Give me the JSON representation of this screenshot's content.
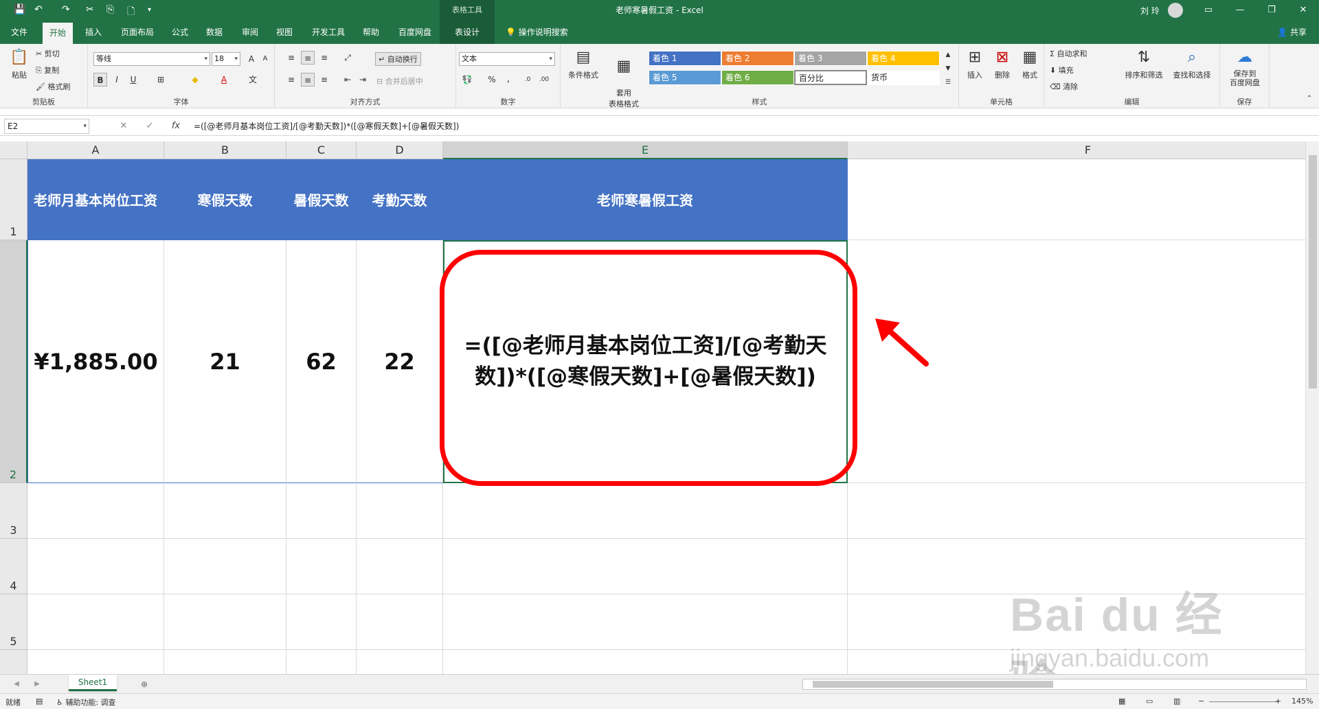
{
  "window": {
    "doc_title": "老师寒暑假工资 - Excel",
    "context_tools": "表格工具",
    "user_name": "刘 玲"
  },
  "tabs": [
    {
      "label": "文件"
    },
    {
      "label": "开始"
    },
    {
      "label": "插入"
    },
    {
      "label": "页面布局"
    },
    {
      "label": "公式"
    },
    {
      "label": "数据"
    },
    {
      "label": "审阅"
    },
    {
      "label": "视图"
    },
    {
      "label": "开发工具"
    },
    {
      "label": "帮助"
    },
    {
      "label": "百度网盘"
    },
    {
      "label": "表设计"
    }
  ],
  "tell_me": "操作说明搜索",
  "share": "共享",
  "ribbon": {
    "clipboard": {
      "label": "剪贴板",
      "paste": "粘贴",
      "cut": "剪切",
      "copy": "复制",
      "format_painter": "格式刷"
    },
    "font": {
      "label": "字体",
      "font_name": "等线",
      "font_size": "18",
      "bold": "B",
      "italic": "I",
      "underline": "U"
    },
    "alignment": {
      "label": "对齐方式",
      "wrap_text": "自动换行",
      "merge_center": "合并后居中"
    },
    "number": {
      "label": "数字",
      "format": "文本"
    },
    "styles": {
      "label": "样式",
      "conditional": "条件格式",
      "table_format": "套用\n表格格式",
      "cells": [
        {
          "label": "着色 1",
          "color": "#4472c4"
        },
        {
          "label": "着色 2",
          "color": "#ed7d31"
        },
        {
          "label": "着色 3",
          "color": "#a5a5a5"
        },
        {
          "label": "着色 4",
          "color": "#ffc000"
        },
        {
          "label": "着色 5",
          "color": "#5b9bd5"
        },
        {
          "label": "着色 6",
          "color": "#70ad47"
        },
        {
          "label": "百分比",
          "color": "#ffffff"
        },
        {
          "label": "货币",
          "color": "#ffffff"
        }
      ]
    },
    "cells": {
      "label": "单元格",
      "insert": "插入",
      "delete": "删除",
      "format": "格式"
    },
    "editing": {
      "label": "编辑",
      "autosum": "自动求和",
      "fill": "填充",
      "clear": "清除",
      "sort_filter": "排序和筛选",
      "find_select": "查找和选择"
    },
    "save": {
      "label": "保存",
      "save_baidu": "保存到\n百度网盘"
    }
  },
  "formula_bar": {
    "name_box": "E2",
    "formula": "=([@老师月基本岗位工资]/[@考勤天数])*([@寒假天数]+[@暑假天数])"
  },
  "columns": [
    "A",
    "B",
    "C",
    "D",
    "E",
    "F"
  ],
  "rows": [
    "1",
    "2",
    "3",
    "4",
    "5"
  ],
  "table": {
    "headers": [
      "老师月基本岗位工资",
      "寒假天数",
      "暑假天数",
      "考勤天数",
      "老师寒暑假工资"
    ],
    "row": [
      "¥1,885.00",
      "21",
      "62",
      "22",
      "=([@老师月基本岗位工资]/[@考勤天数])*([@寒假天数]+[@暑假天数])"
    ],
    "header_color": "#4472c4"
  },
  "sheet_tab": "Sheet1",
  "status": {
    "ready": "就绪",
    "accessibility": "辅助功能: 调查",
    "zoom": "145%"
  },
  "watermark": {
    "main": "Bai du 经验",
    "sub": "jingyan.baidu.com"
  },
  "accent_color": "#217346",
  "annotation_color": "#ff0000"
}
